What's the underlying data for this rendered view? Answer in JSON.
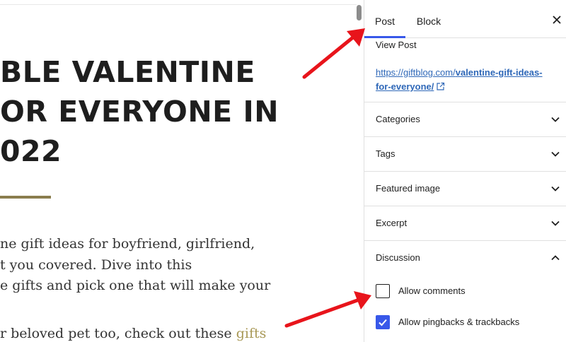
{
  "editor": {
    "title_lines": [
      "BLE VALENTINE",
      "OR EVERYONE IN",
      "022"
    ],
    "paragraph1": [
      "ne gift ideas for boyfriend, girlfriend,",
      "t you covered. Dive into this",
      "e gifts and pick one that will make your"
    ],
    "paragraph2_text": "r beloved pet too, check out these ",
    "paragraph2_link": "gifts"
  },
  "sidebar": {
    "tabs": [
      {
        "label": "Post",
        "active": true
      },
      {
        "label": "Block",
        "active": false
      }
    ],
    "close_icon": "close-icon",
    "view_post_label": "View Post",
    "post_link": {
      "prefix": "https://giftblog.com/",
      "slug_line1": "valentine-gift-ideas-",
      "slug_line2": "for-everyone/"
    },
    "panels": [
      {
        "title": "Categories",
        "expanded": false
      },
      {
        "title": "Tags",
        "expanded": false
      },
      {
        "title": "Featured image",
        "expanded": false
      },
      {
        "title": "Excerpt",
        "expanded": false
      },
      {
        "title": "Discussion",
        "expanded": true
      }
    ],
    "discussion": {
      "allow_comments": {
        "label": "Allow comments",
        "checked": false
      },
      "allow_pingbacks": {
        "label": "Allow pingbacks & trackbacks",
        "checked": true
      }
    }
  },
  "colors": {
    "accent": "#3858e9",
    "link": "#2f68b8",
    "annotation_arrow": "#e8141b",
    "title_rule": "#8a7d4e"
  }
}
